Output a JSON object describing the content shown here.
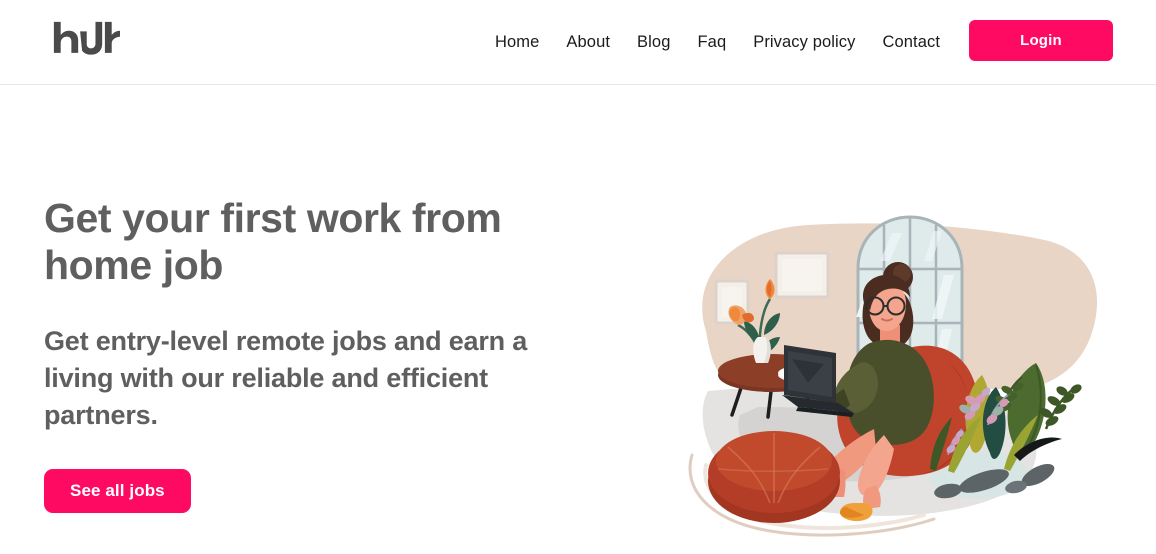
{
  "header": {
    "brand": {
      "name": "hJh",
      "icon": "hjh-wordmark-logo"
    },
    "nav_items": [
      {
        "label": "Home"
      },
      {
        "label": "About"
      },
      {
        "label": "Blog"
      },
      {
        "label": "Faq"
      },
      {
        "label": "Privacy policy"
      },
      {
        "label": "Contact"
      }
    ],
    "login_label": "Login"
  },
  "hero": {
    "title": "Get your first work from home job",
    "subtitle": "Get entry-level remote jobs and earn a living with our reliable and efficient partners.",
    "cta_label": "See all jobs",
    "illustration": {
      "name": "woman-working-from-home-illustration",
      "alt": "Woman in glasses sitting in a red beanbag chair with a laptop beside an arched window, coffee table with flowers, plants and a pouf"
    }
  },
  "colors": {
    "accent_pink": "#ff0a63",
    "heading_gray": "#5f5f60",
    "nav_text": "#1b1b1b",
    "header_border": "#e8e8e8",
    "page_background": "#ffffff",
    "illustration_wall_beige": "#e8d5c6",
    "illustration_floor_gray": "#e4e3e1",
    "illustration_beanbag_red": "#c0442c",
    "illustration_sweater_olive": "#4a4f2b",
    "illustration_skin": "#ef8f78",
    "illustration_hair_brown": "#4a2c20",
    "illustration_window_pale": "#dfeaea",
    "illustration_plant_green": "#4c6b2f",
    "illustration_pouf_rust": "#b33d26",
    "illustration_stone_gray": "#5c6468",
    "illustration_flower_orange": "#ef8a3c"
  }
}
